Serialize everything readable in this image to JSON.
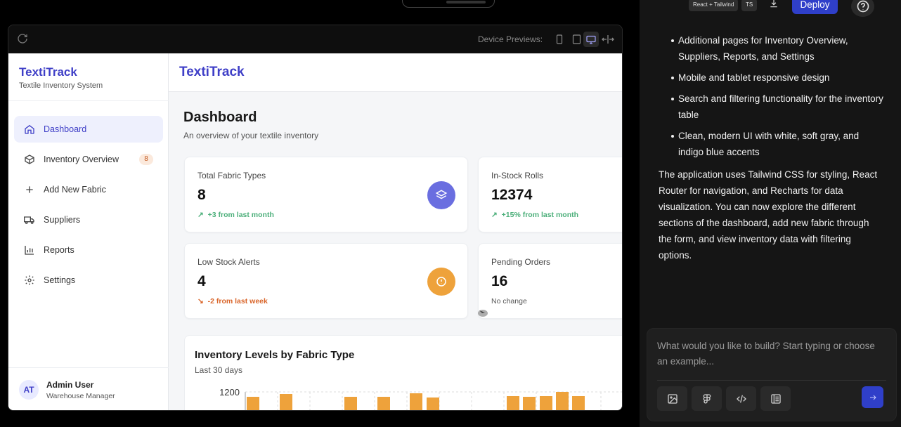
{
  "preview": {
    "device_label": "Device Previews:"
  },
  "sidebar": {
    "brand": "TextiTrack",
    "brand_sub": "Textile Inventory System",
    "items": [
      {
        "label": "Dashboard",
        "icon": "home-icon",
        "active": true
      },
      {
        "label": "Inventory Overview",
        "icon": "box-icon",
        "badge": "8"
      },
      {
        "label": "Add New Fabric",
        "icon": "plus-icon"
      },
      {
        "label": "Suppliers",
        "icon": "truck-icon"
      },
      {
        "label": "Reports",
        "icon": "bar-chart-icon"
      },
      {
        "label": "Settings",
        "icon": "gear-icon"
      }
    ],
    "user": {
      "initials": "AT",
      "name": "Admin User",
      "role": "Warehouse Manager"
    }
  },
  "main": {
    "brand": "TextiTrack",
    "title": "Dashboard",
    "subtitle": "An overview of your textile inventory",
    "cards": [
      {
        "title": "Total Fabric Types",
        "value": "8",
        "trend": "+3 from last month",
        "trend_type": "up",
        "icon": "layers-icon",
        "icon_color": "#6a6ee0"
      },
      {
        "title": "In-Stock Rolls",
        "value": "12374",
        "trend": "+15% from last month",
        "trend_type": "up"
      },
      {
        "title": "Low Stock Alerts",
        "value": "4",
        "trend": "-2 from last week",
        "trend_type": "down",
        "icon": "alert-circle-icon",
        "icon_color": "#eea23b"
      },
      {
        "title": "Pending Orders",
        "value": "16",
        "trend": "No change",
        "trend_type": "none"
      }
    ],
    "chart": {
      "title": "Inventory Levels by Fabric Type",
      "subtitle": "Last 30 days"
    }
  },
  "chart_data": {
    "type": "bar",
    "title": "Inventory Levels by Fabric Type",
    "subtitle": "Last 30 days",
    "y_tick_visible": "1200",
    "bar_color": "#eea23b",
    "values": [
      1130,
      1170,
      1130,
      1130,
      1180,
      1120,
      1140,
      1130,
      1140,
      1200,
      1140
    ]
  },
  "right_panel": {
    "chips": [
      "React + Tailwind",
      "TS"
    ],
    "deploy_label": "Deploy",
    "bullets": [
      "Additional pages for Inventory Overview, Suppliers, Reports, and Settings",
      "Mobile and tablet responsive design",
      "Search and filtering functionality for the inventory table",
      "Clean, modern UI with white, soft gray, and indigo blue accents"
    ],
    "paragraph": "The application uses Tailwind CSS for styling, React Router for navigation, and Recharts for data visualization. You can now explore the different sections of the dashboard, add new fabric through the form, and view inventory data with filtering options.",
    "composer_placeholder": "What would you like to build? Start typing or choose an example..."
  }
}
